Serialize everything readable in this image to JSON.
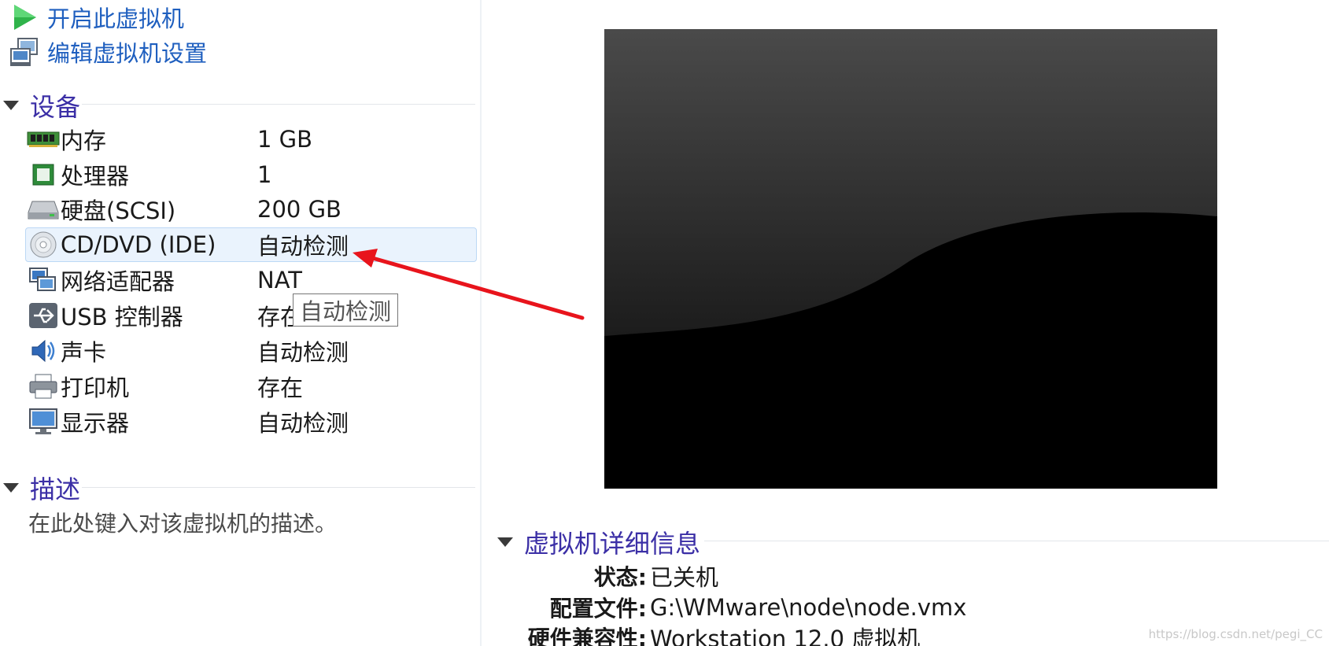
{
  "actions": {
    "power_on": "开启此虚拟机",
    "edit_settings": "编辑虚拟机设置"
  },
  "devices": {
    "heading": "设备",
    "items": [
      {
        "name": "内存",
        "value": "1 GB",
        "icon": "memory-icon"
      },
      {
        "name": "处理器",
        "value": "1",
        "icon": "processor-icon"
      },
      {
        "name": "硬盘(SCSI)",
        "value": "200 GB",
        "icon": "hard-disk-icon"
      },
      {
        "name": "CD/DVD (IDE)",
        "value": "自动检测",
        "icon": "cd-dvd-icon",
        "selected": true
      },
      {
        "name": "网络适配器",
        "value": "NAT",
        "icon": "network-adapter-icon"
      },
      {
        "name": "USB 控制器",
        "value": "存在",
        "icon": "usb-icon"
      },
      {
        "name": "声卡",
        "value": "自动检测",
        "icon": "sound-card-icon"
      },
      {
        "name": "打印机",
        "value": "存在",
        "icon": "printer-icon"
      },
      {
        "name": "显示器",
        "value": "自动检测",
        "icon": "display-icon"
      }
    ]
  },
  "tooltip": "自动检测",
  "description": {
    "heading": "描述",
    "placeholder": "在此处键入对该虚拟机的描述。"
  },
  "details": {
    "heading": "虚拟机详细信息",
    "rows": [
      {
        "label": "状态:",
        "value": "已关机"
      },
      {
        "label": "配置文件:",
        "value": "G:\\WMware\\node\\node.vmx"
      },
      {
        "label": "硬件兼容性:",
        "value": "Workstation 12.0 虚拟机"
      }
    ]
  },
  "watermark": "https://blog.csdn.net/pegi_CC",
  "colors": {
    "link_blue": "#1f5fbf",
    "heading_purple": "#3b2fa6",
    "annotation_red": "#e8141c",
    "selection_bg": "#eaf3fd"
  }
}
